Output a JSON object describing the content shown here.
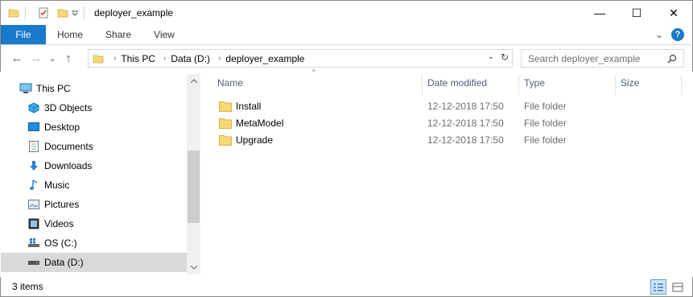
{
  "window": {
    "title": "deployer_example",
    "controls": {
      "minimize": "—",
      "maximize": "☐",
      "close": "✕"
    }
  },
  "ribbon": {
    "tabs": [
      "File",
      "Home",
      "Share",
      "View"
    ],
    "collapse_glyph": "⌄",
    "help_glyph": "?"
  },
  "address": {
    "back_glyph": "←",
    "forward_glyph": "→",
    "recent_glyph": "⌄",
    "up_glyph": "↑",
    "crumbs": [
      "This PC",
      "Data (D:)",
      "deployer_example"
    ],
    "crumb_separator": "›",
    "dropdown_glyph": "⌄",
    "refresh_glyph": "↻"
  },
  "search": {
    "placeholder": "Search deployer_example"
  },
  "nav": {
    "items": [
      {
        "label": "This PC",
        "icon": "computer-icon"
      },
      {
        "label": "3D Objects",
        "icon": "cube-icon"
      },
      {
        "label": "Desktop",
        "icon": "desktop-icon"
      },
      {
        "label": "Documents",
        "icon": "documents-icon"
      },
      {
        "label": "Downloads",
        "icon": "downloads-icon"
      },
      {
        "label": "Music",
        "icon": "music-icon"
      },
      {
        "label": "Pictures",
        "icon": "pictures-icon"
      },
      {
        "label": "Videos",
        "icon": "videos-icon"
      },
      {
        "label": "OS (C:)",
        "icon": "drive-windows-icon"
      },
      {
        "label": "Data (D:)",
        "icon": "drive-icon",
        "selected": true
      }
    ]
  },
  "list": {
    "columns": {
      "name": "Name",
      "date": "Date modified",
      "type": "Type",
      "size": "Size"
    },
    "sort_glyph": "^",
    "rows": [
      {
        "name": "Install",
        "date": "12-12-2018 17:50",
        "type": "File folder",
        "size": ""
      },
      {
        "name": "MetaModel",
        "date": "12-12-2018 17:50",
        "type": "File folder",
        "size": ""
      },
      {
        "name": "Upgrade",
        "date": "12-12-2018 17:50",
        "type": "File folder",
        "size": ""
      }
    ]
  },
  "status": {
    "item_count": "3 items"
  },
  "colors": {
    "accent": "#1979ca",
    "folder": "#f8d775",
    "selected": "#d9d9d9",
    "header_text": "#4c607a"
  }
}
